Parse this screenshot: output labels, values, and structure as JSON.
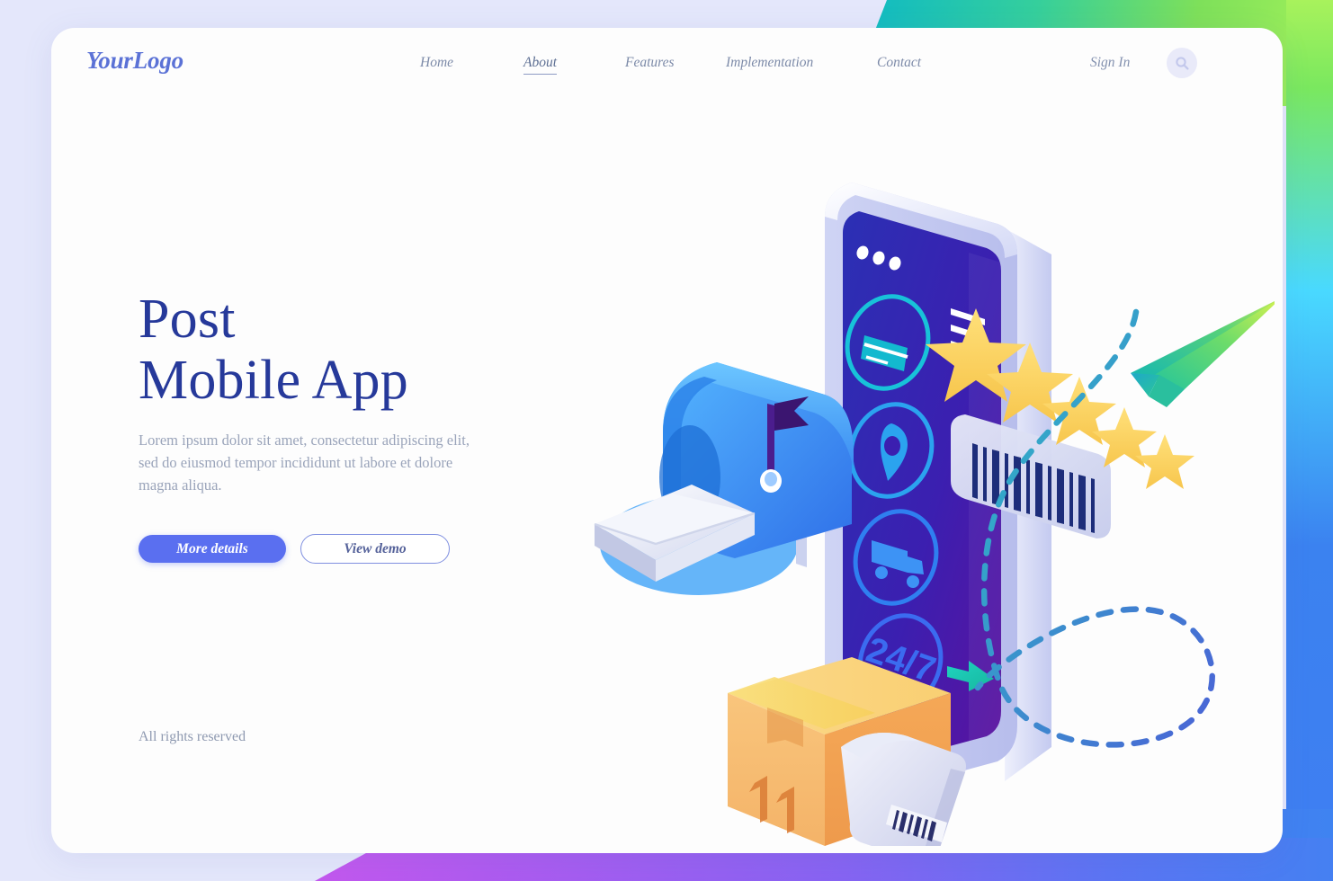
{
  "brand": {
    "logo": "YourLogo",
    "accent": "#5a6ff0",
    "heading_color": "#26399a"
  },
  "header": {
    "nav": [
      {
        "label": "Home",
        "active": false
      },
      {
        "label": "About",
        "active": true
      },
      {
        "label": "Features",
        "active": false
      },
      {
        "label": "Implementation",
        "active": false
      },
      {
        "label": "Contact",
        "active": false
      }
    ],
    "signin": "Sign In",
    "search_icon": "search-icon"
  },
  "hero": {
    "title_line1": "Post",
    "title_line2": "Mobile App",
    "subtitle": "Lorem ipsum dolor sit amet, consectetur adipiscing elit, sed do eiusmod tempor incididunt ut labore et dolore magna aliqua.",
    "primary_button": "More details",
    "secondary_button": "View demo"
  },
  "footer": {
    "rights": "All rights reserved"
  },
  "illustration": {
    "name": "post-mobile-app-isometric-illustration",
    "phone": {
      "screen_gradient": [
        "#2b2fae",
        "#5a14a8"
      ],
      "dots": 3,
      "menu_icon": "hamburger-icon",
      "app_icons": [
        {
          "name": "card-icon",
          "label": ""
        },
        {
          "name": "location-pin-icon",
          "label": ""
        },
        {
          "name": "delivery-truck-icon",
          "label": ""
        },
        {
          "name": "service-hours-icon",
          "label": "24/7"
        }
      ]
    },
    "mailbox": {
      "name": "mailbox-icon",
      "color": "#3d9bf5",
      "flag_color": "#3b1570"
    },
    "envelope": {
      "name": "envelope-icon",
      "color": "#e8ebf7"
    },
    "parcel_box": {
      "name": "cardboard-box-icon",
      "color": "#f6b063",
      "arrows": 2
    },
    "parcel_bag": {
      "name": "parcel-bag-icon",
      "color": "#d3d6ef",
      "barcode": true
    },
    "barcode_card": {
      "name": "barcode-card-icon",
      "bars": 12
    },
    "stars": {
      "name": "rating-stars",
      "count": 5,
      "color": "#ffd966"
    },
    "paper_plane": {
      "name": "paper-plane-icon",
      "gradient": [
        "#2ec4a0",
        "#c8f04a"
      ]
    },
    "arrow": {
      "name": "arrow-right-icon",
      "color": "#1fc6b4"
    },
    "trail": {
      "name": "dashed-flight-path",
      "colors": [
        "#2bbfc4",
        "#4a63d6"
      ]
    }
  },
  "decor": {
    "top_right_gradient": [
      "#0cb8c8",
      "#a4f25a"
    ],
    "right_edge_gradient": [
      "#a8f25c",
      "#3f7ef2"
    ],
    "bottom_left_gradient": [
      "#c358ee",
      "#4580f2"
    ],
    "page_background": "#e4e7fb"
  }
}
